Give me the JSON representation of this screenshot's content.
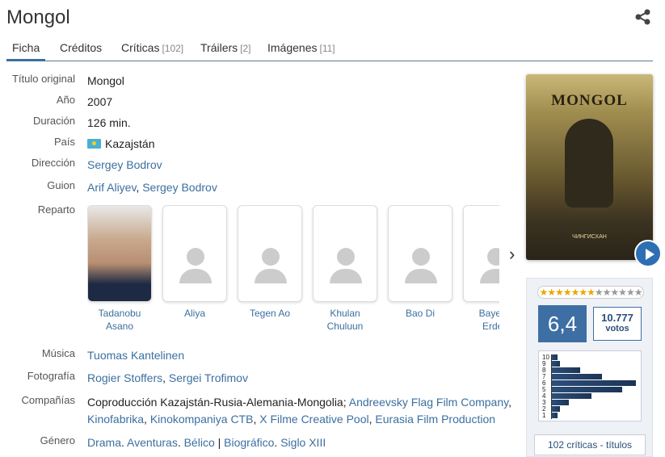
{
  "page": {
    "title": "Mongol"
  },
  "tabs": [
    {
      "label": "Ficha",
      "count": ""
    },
    {
      "label": "Créditos",
      "count": ""
    },
    {
      "label": "Críticas",
      "count": "[102]"
    },
    {
      "label": "Tráilers",
      "count": "[2]"
    },
    {
      "label": "Imágenes",
      "count": "[11]"
    }
  ],
  "details": {
    "titulo_original": {
      "label": "Título original",
      "value": "Mongol"
    },
    "anio": {
      "label": "Año",
      "value": "2007"
    },
    "duracion": {
      "label": "Duración",
      "value": "126 min."
    },
    "pais": {
      "label": "País",
      "value": "Kazajstán"
    },
    "direccion": {
      "label": "Dirección",
      "value": "Sergey Bodrov"
    },
    "guion": {
      "label": "Guion",
      "links": [
        "Arif Aliyev",
        "Sergey Bodrov"
      ]
    },
    "reparto": {
      "label": "Reparto"
    },
    "musica": {
      "label": "Música",
      "value": "Tuomas Kantelinen"
    },
    "fotografia": {
      "label": "Fotografía",
      "links": [
        "Rogier Stoffers",
        "Sergei Trofimov"
      ]
    },
    "companias": {
      "label": "Compañías",
      "prefix": "Coproducción Kazajstán-Rusia-Alemania-Mongolia;",
      "links": [
        "Andreevsky Flag Film Company",
        "Kinofabrika",
        "Kinokompaniya CTB",
        "X Filme Creative Pool",
        "Eurasia Film Production"
      ]
    },
    "genero": {
      "label": "Género",
      "links": [
        "Drama",
        "Aventuras",
        "Bélico",
        "Biográfico",
        "Siglo XIII"
      ]
    }
  },
  "cast": [
    {
      "name_l1": "Tadanobu",
      "name_l2": "Asano"
    },
    {
      "name_l1": "Aliya",
      "name_l2": ""
    },
    {
      "name_l1": "Tegen Ao",
      "name_l2": ""
    },
    {
      "name_l1": "Khulan",
      "name_l2": "Chuluun"
    },
    {
      "name_l1": "Bao Di",
      "name_l2": ""
    },
    {
      "name_l1": "Bayerts",
      "name_l2": "Erden"
    }
  ],
  "poster": {
    "title": "MONGOL",
    "subtitle": "ЧИНГИСХАН"
  },
  "rating": {
    "stars_filled": 7,
    "stars_total": 13,
    "score": "6,4",
    "votes_count": "10.777",
    "votes_label": "votos",
    "histogram_labels": [
      "10",
      "9",
      "8",
      "7",
      "6",
      "5",
      "4",
      "3",
      "2",
      "1"
    ],
    "histogram_values": [
      2,
      3,
      10,
      18,
      30,
      25,
      14,
      6,
      3,
      2
    ],
    "critics_link": "102 críticas - títulos"
  },
  "colors": {
    "accent": "#3b6fa0",
    "score_bg": "#3e6fa4",
    "star": "#e8a800"
  }
}
